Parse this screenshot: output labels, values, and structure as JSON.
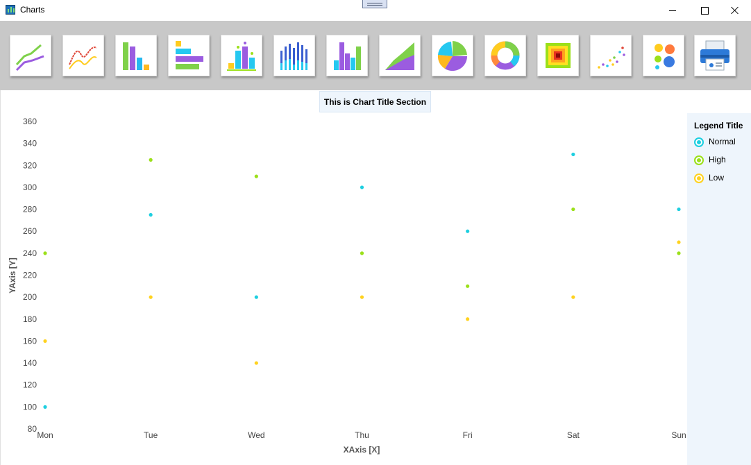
{
  "window": {
    "title": "Charts"
  },
  "toolbar": {
    "buttons": [
      {
        "icon": "line-chart-icon"
      },
      {
        "icon": "spline-chart-icon"
      },
      {
        "icon": "column-chart-icon"
      },
      {
        "icon": "bar-chart-icon"
      },
      {
        "icon": "error-bar-chart-icon"
      },
      {
        "icon": "stacked-column-icon"
      },
      {
        "icon": "grouped-column-icon"
      },
      {
        "icon": "area-chart-icon"
      },
      {
        "icon": "pie-chart-icon"
      },
      {
        "icon": "doughnut-chart-icon"
      },
      {
        "icon": "heatmap-icon"
      },
      {
        "icon": "scatter-chart-icon"
      },
      {
        "icon": "bubble-chart-icon"
      },
      {
        "icon": "print-icon"
      }
    ]
  },
  "legend": {
    "title": "Legend Title",
    "items": [
      {
        "label": "Normal",
        "color": "#1ecfe0"
      },
      {
        "label": "High",
        "color": "#9be01a"
      },
      {
        "label": "Low",
        "color": "#ffd21f"
      }
    ]
  },
  "chart_data": {
    "type": "scatter",
    "title": "This is Chart Title Section",
    "xlabel": "XAxis [X]",
    "ylabel": "YAxis [Y]",
    "categories": [
      "Mon",
      "Tue",
      "Wed",
      "Thu",
      "Fri",
      "Sat",
      "Sun"
    ],
    "ylim": [
      80,
      360
    ],
    "yticks": [
      80,
      100,
      120,
      140,
      160,
      180,
      200,
      220,
      240,
      260,
      280,
      300,
      320,
      340,
      360
    ],
    "grid": false,
    "legend_position": "right",
    "series": [
      {
        "name": "Normal",
        "color": "#1ecfe0",
        "values": [
          100,
          275,
          200,
          300,
          260,
          330,
          280
        ]
      },
      {
        "name": "High",
        "color": "#9be01a",
        "values": [
          240,
          325,
          310,
          240,
          210,
          280,
          240
        ]
      },
      {
        "name": "Low",
        "color": "#ffd21f",
        "values": [
          160,
          200,
          140,
          200,
          180,
          200,
          250
        ]
      }
    ]
  }
}
